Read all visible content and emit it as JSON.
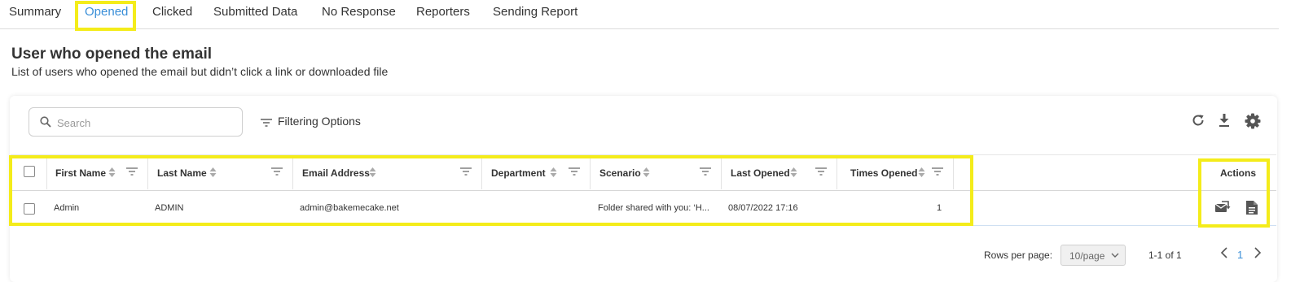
{
  "tabs": [
    {
      "label": "Summary"
    },
    {
      "label": "Opened"
    },
    {
      "label": "Clicked"
    },
    {
      "label": "Submitted Data"
    },
    {
      "label": "No Response"
    },
    {
      "label": "Reporters"
    },
    {
      "label": "Sending Report"
    }
  ],
  "active_tab": "Opened",
  "header": {
    "title": "User who opened the email",
    "subtitle": "List of users who opened the email but didn’t click a link or downloaded file"
  },
  "toolbar": {
    "search_placeholder": "Search",
    "filtering_label": "Filtering Options",
    "icons": [
      "refresh-icon",
      "download-icon",
      "settings-icon"
    ]
  },
  "table": {
    "columns": [
      "First Name",
      "Last Name",
      "Email Address",
      "Department",
      "Scenario",
      "Last Opened",
      "Times Opened"
    ],
    "actions_header": "Actions",
    "rows": [
      {
        "first_name": "Admin",
        "last_name": "ADMIN",
        "email": "admin@bakemecake.net",
        "department": "",
        "scenario": "Folder shared with you: ‘H...",
        "last_opened": "08/07/2022 17:16",
        "times_opened": "1",
        "actions": [
          "resend-email-icon",
          "report-document-icon"
        ]
      }
    ]
  },
  "pagination": {
    "rows_per_page_label": "Rows per page:",
    "rows_per_page_value": "10/page",
    "range_text": "1-1 of 1",
    "current_page": "1"
  },
  "colors": {
    "accent": "#3a8fd8",
    "highlight": "#f4ec1a",
    "text": "#333333"
  }
}
